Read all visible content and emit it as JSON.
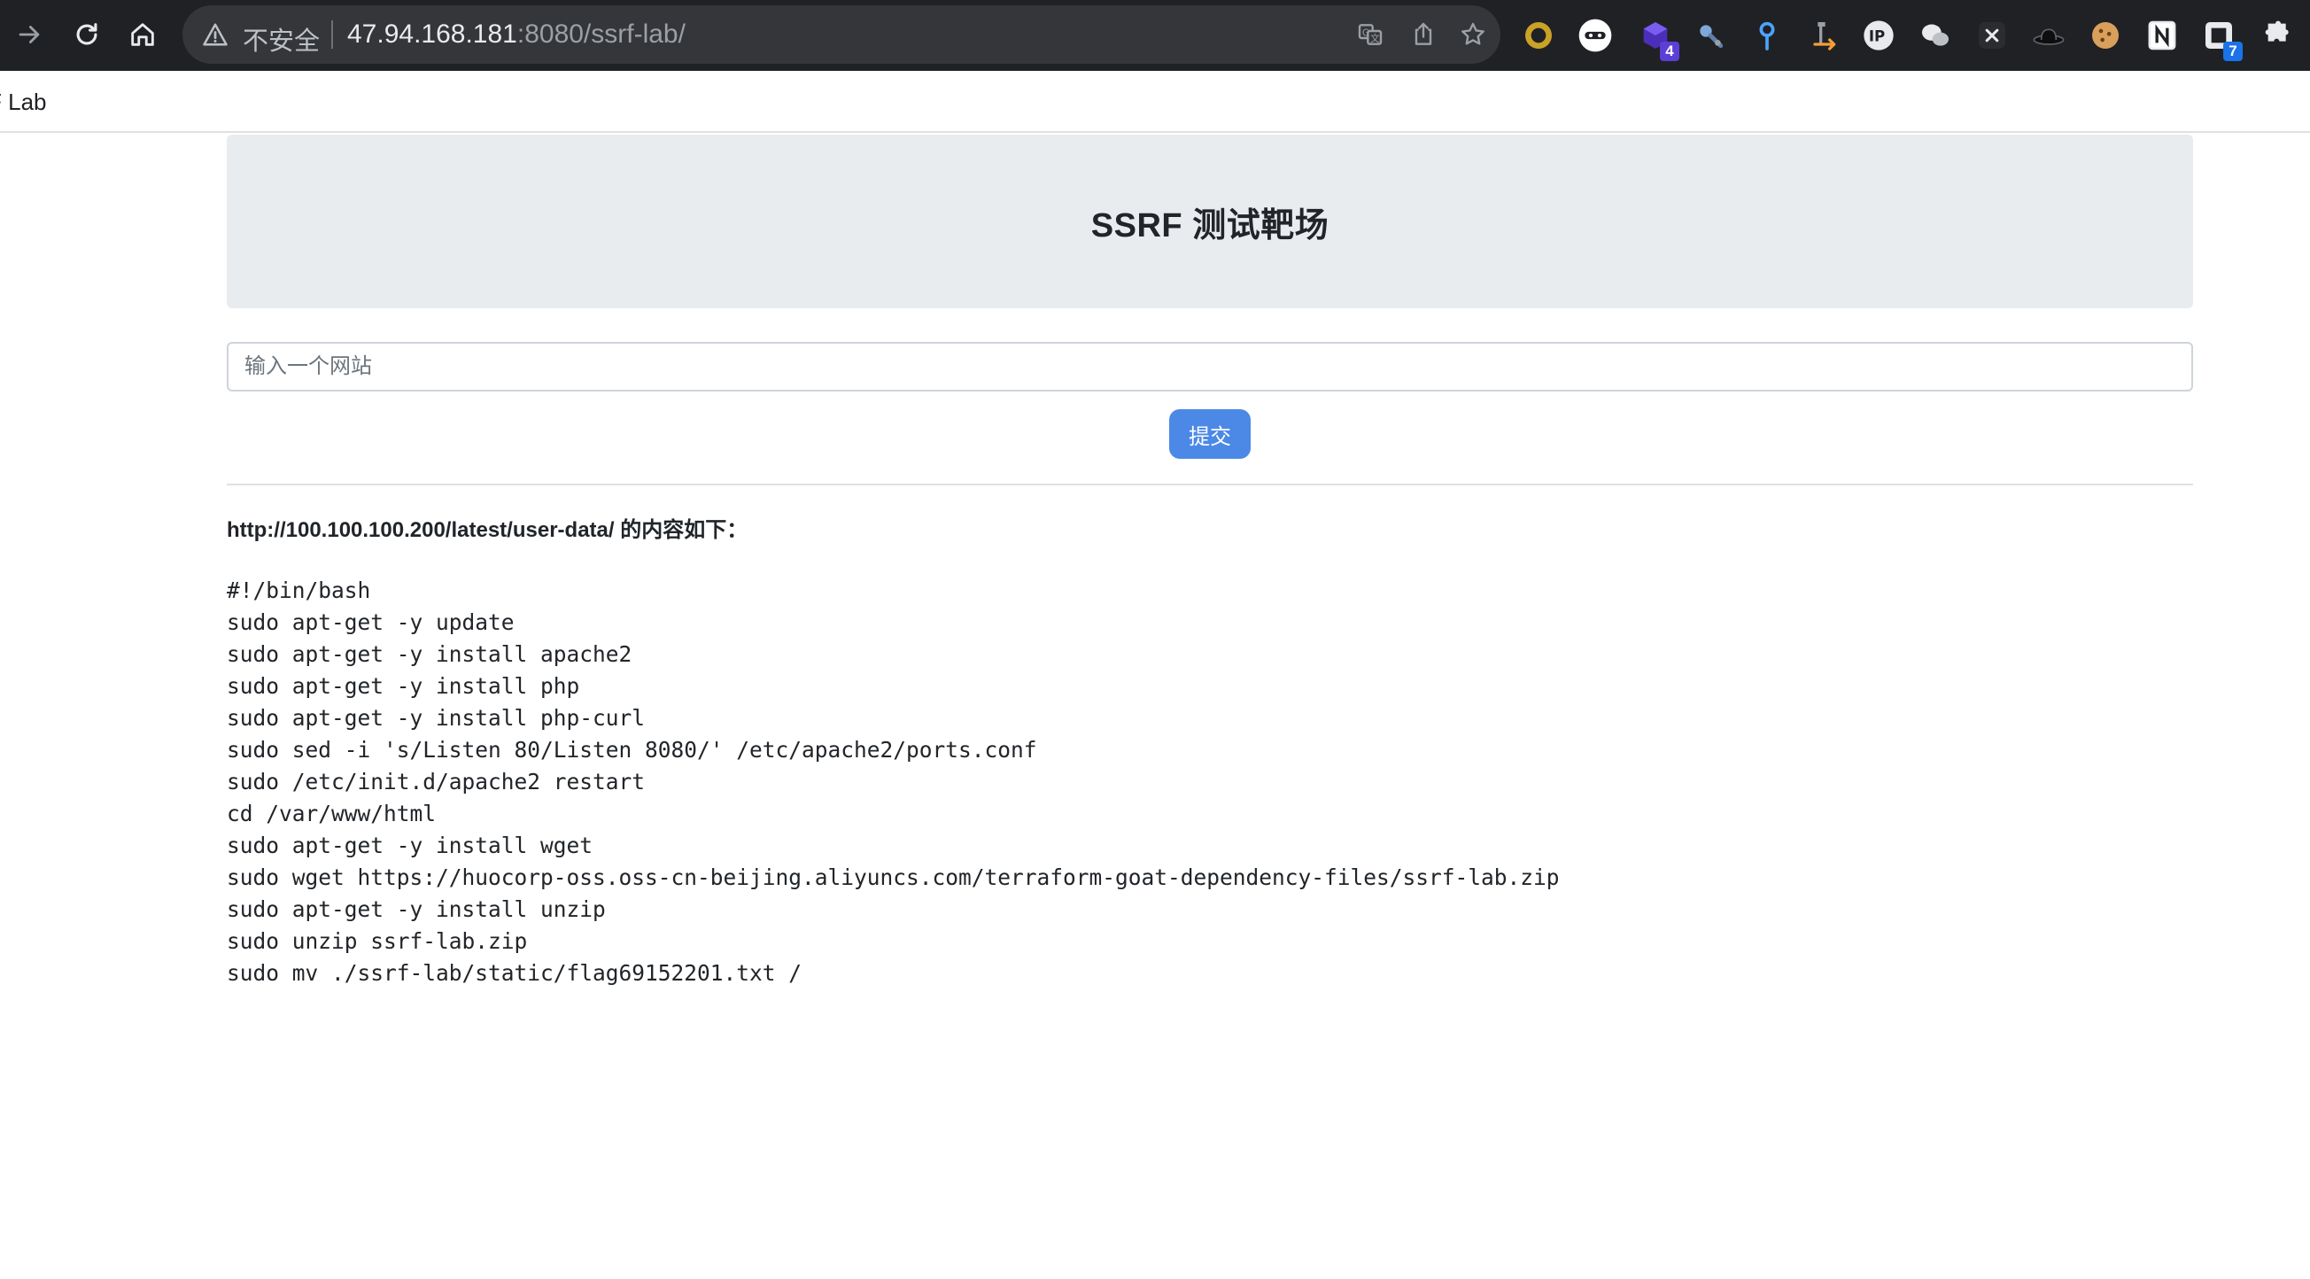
{
  "browser": {
    "insecure_label": "不安全",
    "url_host": "47.94.168.181",
    "url_rest": ":8080/ssrf-lab/",
    "extensions": [
      {
        "name": "ring-ext-icon",
        "badge": ""
      },
      {
        "name": "incognito-mask-ext-icon",
        "badge": ""
      },
      {
        "name": "cube-ext-icon",
        "badge": "4"
      },
      {
        "name": "satellite-ext-icon",
        "badge": ""
      },
      {
        "name": "pin-ext-icon",
        "badge": ""
      },
      {
        "name": "arrow-hammer-ext-icon",
        "badge": ""
      },
      {
        "name": "ip-ext-icon",
        "badge": ""
      },
      {
        "name": "wechat-ext-icon",
        "badge": ""
      },
      {
        "name": "x-ext-icon",
        "badge": ""
      },
      {
        "name": "hat-ext-icon",
        "badge": ""
      },
      {
        "name": "cookie-ext-icon",
        "badge": ""
      },
      {
        "name": "notion-ext-icon",
        "badge": ""
      },
      {
        "name": "puzzle-badge-ext-icon",
        "badge": "7"
      },
      {
        "name": "extensions-puzzle-icon",
        "badge": ""
      }
    ]
  },
  "bookmarks": {
    "item": "F Lab"
  },
  "page": {
    "title": "SSRF 测试靶场",
    "input_placeholder": "输入一个网站",
    "submit_label": "提交",
    "result_url": "http://100.100.100.200/latest/user-data/",
    "result_suffix": " 的内容如下：",
    "output": "#!/bin/bash\nsudo apt-get -y update\nsudo apt-get -y install apache2\nsudo apt-get -y install php\nsudo apt-get -y install php-curl\nsudo sed -i 's/Listen 80/Listen 8080/' /etc/apache2/ports.conf\nsudo /etc/init.d/apache2 restart\ncd /var/www/html\nsudo apt-get -y install wget\nsudo wget https://huocorp-oss.oss-cn-beijing.aliyuncs.com/terraform-goat-dependency-files/ssrf-lab.zip\nsudo apt-get -y install unzip\nsudo unzip ssrf-lab.zip\nsudo mv ./ssrf-lab/static/flag69152201.txt /"
  },
  "colors": {
    "chrome_bg": "#202124",
    "omnibox_bg": "#35363a",
    "jumbotron_bg": "#e9ecef",
    "button_bg": "#4c89e6",
    "badge_purple": "#5b3fd6",
    "badge_blue": "#1a73e8"
  }
}
